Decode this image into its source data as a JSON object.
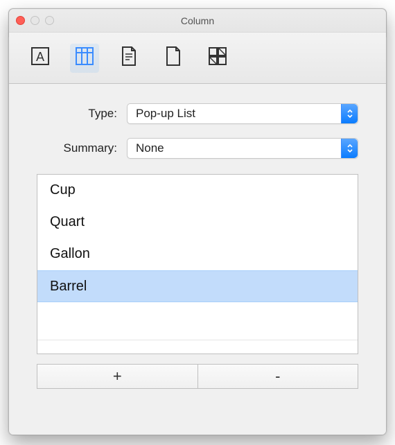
{
  "window": {
    "title": "Column"
  },
  "toolbar": {
    "tabs": [
      {
        "name": "text-style-tab",
        "selected": false
      },
      {
        "name": "column-tab",
        "selected": true
      },
      {
        "name": "document-tab",
        "selected": false
      },
      {
        "name": "page-tab",
        "selected": false
      },
      {
        "name": "layout-tab",
        "selected": false
      }
    ]
  },
  "form": {
    "type_label": "Type:",
    "type_value": "Pop-up List",
    "summary_label": "Summary:",
    "summary_value": "None"
  },
  "list": {
    "items": [
      {
        "label": "Cup",
        "selected": false
      },
      {
        "label": "Quart",
        "selected": false
      },
      {
        "label": "Gallon",
        "selected": false
      },
      {
        "label": "Barrel",
        "selected": true
      }
    ]
  },
  "buttons": {
    "add_label": "+",
    "remove_label": "-"
  }
}
